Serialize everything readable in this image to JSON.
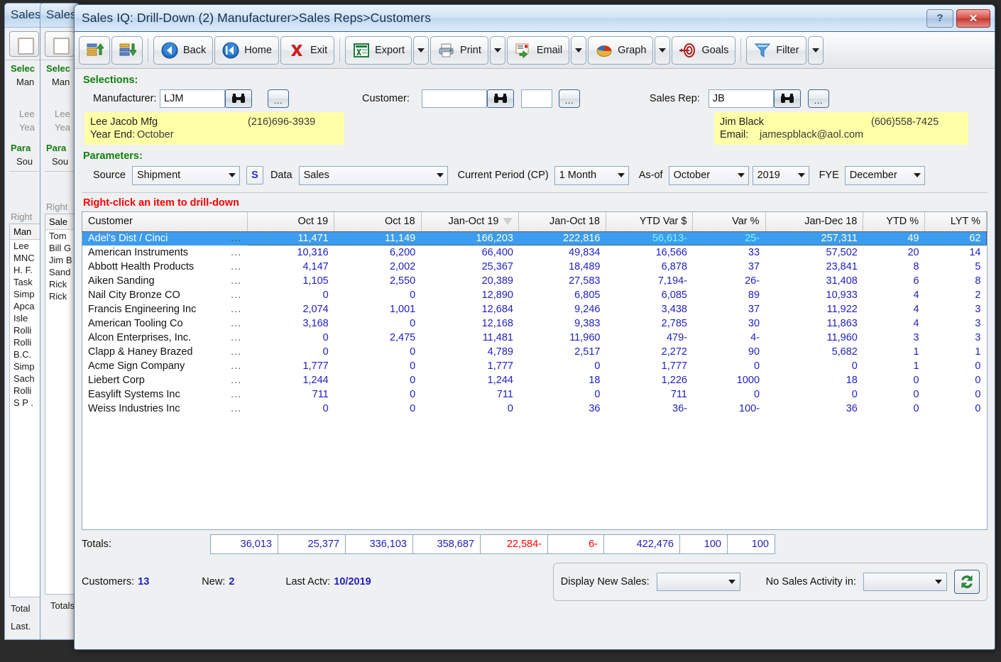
{
  "background_windows": [
    {
      "title": "Sales",
      "selections_label": "Selec",
      "manufacturer_label": "Man",
      "name_line": "Lee",
      "year_line": "Yea",
      "parameters_label": "Para",
      "source_label": "Sou",
      "hint": "Right",
      "list_header": "Man",
      "list_items": [
        "Lee",
        "MNC",
        "H. F.",
        "Task",
        "Simp",
        "Apca",
        "Isle",
        "Rolli",
        "Rolli",
        "B.C.",
        "Simp",
        "Sach",
        "Rolli",
        "S P ."
      ],
      "totals_label": "Total",
      "last_label": "Last."
    },
    {
      "title": "Sales",
      "selections_label": "Selec",
      "manufacturer_label": "Man",
      "name_line": "Lee",
      "year_line": "Yea",
      "parameters_label": "Para",
      "source_label": "Sou",
      "hint": "Right",
      "list_header": "Sale",
      "list_items": [
        "Tom",
        "Bill G",
        "Jim B",
        "Sand",
        "Rick",
        "Rick"
      ],
      "totals_label": "Totals"
    }
  ],
  "window": {
    "title": "Sales IQ: Drill-Down (2) Manufacturer>Sales Reps>Customers",
    "help_button": "?",
    "close_button": "✕"
  },
  "toolbar": {
    "buttons": [
      {
        "name": "expand-up-button",
        "label": "",
        "icon": "rows-up-icon",
        "type": "square"
      },
      {
        "name": "collapse-down-button",
        "label": "",
        "icon": "rows-down-icon",
        "type": "square"
      },
      {
        "name": "back-button",
        "label": "Back",
        "accel": "B",
        "icon": "back-arrow-icon",
        "type": "text"
      },
      {
        "name": "home-button",
        "label": "Home",
        "accel": "H",
        "icon": "home-arrow-icon",
        "type": "text"
      },
      {
        "name": "exit-button",
        "label": "Exit",
        "accel": "x",
        "icon": "red-x-icon",
        "type": "text"
      },
      {
        "name": "export-button",
        "label": "Export",
        "accel": "E",
        "icon": "excel-icon",
        "type": "text",
        "split": true
      },
      {
        "name": "print-button",
        "label": "Print",
        "accel": "P",
        "icon": "printer-icon",
        "type": "text",
        "split": true
      },
      {
        "name": "email-button",
        "label": "Email",
        "accel": "l",
        "icon": "email-icon",
        "type": "text",
        "split": true
      },
      {
        "name": "graph-button",
        "label": "Graph",
        "accel": "G",
        "icon": "pie-chart-icon",
        "type": "text",
        "split": true
      },
      {
        "name": "goals-button",
        "label": "Goals",
        "accel": "a",
        "icon": "target-icon",
        "type": "text"
      },
      {
        "name": "filter-button",
        "label": "Filter",
        "accel": "F",
        "icon": "funnel-icon",
        "type": "text",
        "split": true
      }
    ]
  },
  "selections": {
    "heading": "Selections:",
    "manufacturer": {
      "label": "Manufacturer:",
      "value": "LJM",
      "info_name": "Lee Jacob Mfg",
      "info_phone": "(216)696-3939",
      "year_end_label": "Year End:",
      "year_end_value": "October"
    },
    "customer": {
      "label": "Customer:",
      "value": "",
      "value2": ""
    },
    "sales_rep": {
      "label": "Sales Rep:",
      "value": "JB",
      "info_name": "Jim Black",
      "info_phone": "(606)558-7425",
      "email_label": "Email:",
      "email_value": "jamespblack@aol.com"
    }
  },
  "parameters": {
    "heading": "Parameters:",
    "source_label": "Source",
    "source_value": "Shipment",
    "s_button": "S",
    "data_label": "Data",
    "data_value": "Sales",
    "current_period_label": "Current Period (CP)",
    "current_period_value": "1 Month",
    "asof_label": "As-of",
    "asof_month": "October",
    "asof_year": "2019",
    "fye_label": "FYE",
    "fye_value": "December"
  },
  "grid": {
    "hint": "Right-click an item to drill-down",
    "columns": [
      "Customer",
      "Oct 19",
      "Oct 18",
      "Jan-Oct 19",
      "Jan-Oct 18",
      "YTD Var $",
      "Var %",
      "Jan-Dec 18",
      "YTD %",
      "LYT %"
    ],
    "sorted_column_index": 3,
    "rows": [
      {
        "selected": true,
        "cells": [
          "Adel's Dist / Cinci",
          "11,471",
          "11,149",
          "166,203",
          "222,816",
          "56,613-",
          "25-",
          "257,311",
          "49",
          "62"
        ],
        "negatives": [
          5,
          6
        ]
      },
      {
        "selected": false,
        "cells": [
          "American Instruments",
          "10,316",
          "6,200",
          "66,400",
          "49,834",
          "16,566",
          "33",
          "57,502",
          "20",
          "14"
        ],
        "negatives": []
      },
      {
        "selected": false,
        "cells": [
          "Abbott Health Products",
          "4,147",
          "2,002",
          "25,367",
          "18,489",
          "6,878",
          "37",
          "23,841",
          "8",
          "5"
        ],
        "negatives": []
      },
      {
        "selected": false,
        "cells": [
          "Aiken Sanding",
          "1,105",
          "2,550",
          "20,389",
          "27,583",
          "7,194-",
          "26-",
          "31,408",
          "6",
          "8"
        ],
        "negatives": [
          5,
          6
        ]
      },
      {
        "selected": false,
        "cells": [
          "Nail City Bronze CO",
          "0",
          "0",
          "12,890",
          "6,805",
          "6,085",
          "89",
          "10,933",
          "4",
          "2"
        ],
        "negatives": []
      },
      {
        "selected": false,
        "cells": [
          "Francis Engineering Inc",
          "2,074",
          "1,001",
          "12,684",
          "9,246",
          "3,438",
          "37",
          "11,922",
          "4",
          "3"
        ],
        "negatives": []
      },
      {
        "selected": false,
        "cells": [
          "American Tooling Co",
          "3,168",
          "0",
          "12,168",
          "9,383",
          "2,785",
          "30",
          "11,863",
          "4",
          "3"
        ],
        "negatives": []
      },
      {
        "selected": false,
        "cells": [
          "Alcon Enterprises, Inc.",
          "0",
          "2,475",
          "11,481",
          "11,960",
          "479-",
          "4-",
          "11,960",
          "3",
          "3"
        ],
        "negatives": [
          5,
          6
        ]
      },
      {
        "selected": false,
        "cells": [
          "Clapp & Haney Brazed",
          "0",
          "0",
          "4,789",
          "2,517",
          "2,272",
          "90",
          "5,682",
          "1",
          "1"
        ],
        "negatives": []
      },
      {
        "selected": false,
        "cells": [
          "Acme Sign Company",
          "1,777",
          "0",
          "1,777",
          "0",
          "1,777",
          "0",
          "0",
          "1",
          "0"
        ],
        "negatives": []
      },
      {
        "selected": false,
        "cells": [
          "Liebert Corp",
          "1,244",
          "0",
          "1,244",
          "18",
          "1,226",
          "1000",
          "18",
          "0",
          "0"
        ],
        "negatives": []
      },
      {
        "selected": false,
        "cells": [
          "Easylift Systems Inc",
          "711",
          "0",
          "711",
          "0",
          "711",
          "0",
          "0",
          "0",
          "0"
        ],
        "negatives": []
      },
      {
        "selected": false,
        "cells": [
          "Weiss Industries Inc",
          "0",
          "0",
          "0",
          "36",
          "36-",
          "100-",
          "36",
          "0",
          "0"
        ],
        "negatives": [
          5,
          6
        ]
      }
    ],
    "row_ellipsis": "..."
  },
  "totals": {
    "label": "Totals:",
    "values": [
      "36,013",
      "25,377",
      "336,103",
      "358,687",
      "22,584-",
      "6-",
      "422,476",
      "100",
      "100"
    ],
    "negatives": [
      4,
      5
    ]
  },
  "footer": {
    "customers_label": "Customers:",
    "customers_value": "13",
    "new_label": "New:",
    "new_value": "2",
    "last_actv_label": "Last Actv:",
    "last_actv_value": "10/2019",
    "display_new_sales_label": "Display New Sales:",
    "display_new_sales_value": "",
    "no_sales_activity_label": "No Sales Activity in:",
    "no_sales_activity_value": "",
    "refresh_icon": "refresh-icon"
  },
  "colors": {
    "accent_blue": "#3b9cf0",
    "negative_red": "#ff0000",
    "data_blue": "#2020c0",
    "heading_green": "#108010",
    "hint_red": "#ff0000",
    "highlight_yellow": "#ffffa8"
  }
}
